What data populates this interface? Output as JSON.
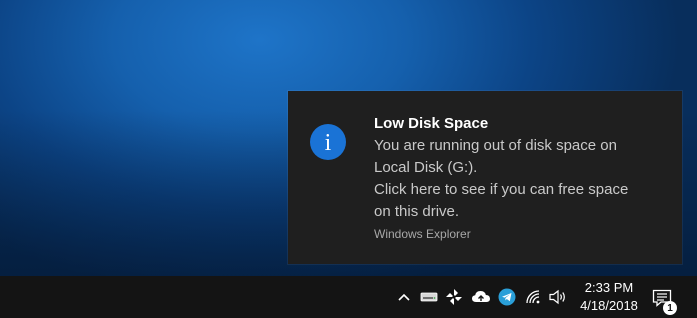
{
  "notification": {
    "title": "Low Disk Space",
    "line1": "You are running out of disk space on",
    "line2": "Local Disk (G:).",
    "line3": "Click here to see if you can free space",
    "line4": "on this drive.",
    "source": "Windows Explorer",
    "icon": "info-icon",
    "icon_glyph": "i",
    "accent_color": "#1a73d6"
  },
  "taskbar": {
    "tray_icons": [
      "chevron-up-icon",
      "drive-icon",
      "pinwheel-icon",
      "cloud-upload-icon",
      "telegram-icon",
      "wifi-icon",
      "speaker-icon",
      "action-center-icon"
    ],
    "time": "2:33 PM",
    "date": "4/18/2018",
    "notification_count": "1"
  }
}
